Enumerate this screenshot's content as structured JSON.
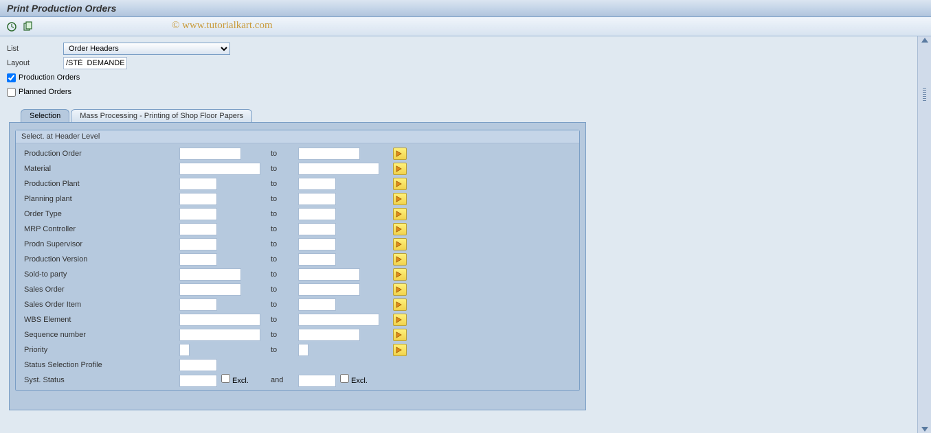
{
  "title": "Print Production Orders",
  "watermark": "© www.tutorialkart.com",
  "top": {
    "list_label": "List",
    "list_value": "Order Headers",
    "layout_label": "Layout",
    "layout_value": "/STÉ  DEMANDE",
    "chk_prod_orders": "Production Orders",
    "chk_planned_orders": "Planned Orders"
  },
  "tabs": {
    "selection": "Selection",
    "mass": "Mass Processing - Printing of Shop Floor Papers"
  },
  "group_title": "Select. at Header Level",
  "to_label": "to",
  "and_label": "and",
  "excl_label": "Excl.",
  "rows": [
    {
      "label": "Production Order",
      "fw": "w-mid",
      "tw": "w-mid",
      "multi": true
    },
    {
      "label": "Material",
      "fw": "w-long",
      "tw": "w-long",
      "multi": true
    },
    {
      "label": "Production Plant",
      "fw": "w-short",
      "tw": "w-short",
      "multi": true
    },
    {
      "label": "Planning plant",
      "fw": "w-short",
      "tw": "w-short",
      "multi": true
    },
    {
      "label": "Order Type",
      "fw": "w-short",
      "tw": "w-short",
      "multi": true
    },
    {
      "label": "MRP Controller",
      "fw": "w-short",
      "tw": "w-short",
      "multi": true
    },
    {
      "label": "Prodn Supervisor",
      "fw": "w-short",
      "tw": "w-short",
      "multi": true
    },
    {
      "label": "Production Version",
      "fw": "w-short",
      "tw": "w-short",
      "multi": true
    },
    {
      "label": "Sold-to party",
      "fw": "w-mid",
      "tw": "w-mid",
      "multi": true
    },
    {
      "label": "Sales Order",
      "fw": "w-mid",
      "tw": "w-mid",
      "multi": true
    },
    {
      "label": "Sales Order Item",
      "fw": "w-short",
      "tw": "w-short",
      "multi": true
    },
    {
      "label": "WBS Element",
      "fw": "w-long",
      "tw": "w-long",
      "multi": true
    },
    {
      "label": "Sequence number",
      "fw": "w-long",
      "tw": "w-mid",
      "multi": true
    },
    {
      "label": "Priority",
      "fw": "w-xs",
      "tw": "w-xs",
      "multi": true
    },
    {
      "label": "Status Selection Profile",
      "fw": "w-short",
      "tw": "",
      "multi": false
    },
    {
      "label": "Syst. Status",
      "fw": "w-short",
      "tw": "",
      "multi": false,
      "syst": true
    }
  ]
}
